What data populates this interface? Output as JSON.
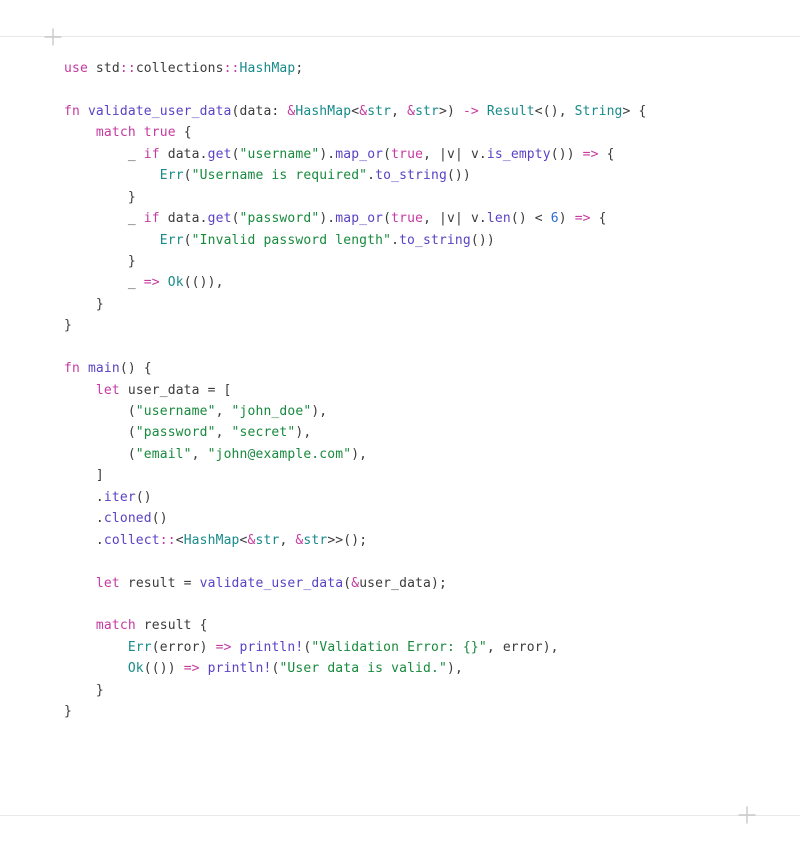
{
  "code": {
    "lines": [
      [
        {
          "cls": "kw",
          "t": "use"
        },
        {
          "cls": "pun",
          "t": " "
        },
        {
          "cls": "path",
          "t": "std"
        },
        {
          "cls": "op",
          "t": "::"
        },
        {
          "cls": "path",
          "t": "collections"
        },
        {
          "cls": "op",
          "t": "::"
        },
        {
          "cls": "ty",
          "t": "HashMap"
        },
        {
          "cls": "pun",
          "t": ";"
        }
      ],
      [],
      [
        {
          "cls": "kw",
          "t": "fn"
        },
        {
          "cls": "pun",
          "t": " "
        },
        {
          "cls": "fn",
          "t": "validate_user_data"
        },
        {
          "cls": "pun",
          "t": "(data: "
        },
        {
          "cls": "op",
          "t": "&"
        },
        {
          "cls": "ty",
          "t": "HashMap"
        },
        {
          "cls": "pun",
          "t": "<"
        },
        {
          "cls": "op",
          "t": "&"
        },
        {
          "cls": "ty",
          "t": "str"
        },
        {
          "cls": "pun",
          "t": ", "
        },
        {
          "cls": "op",
          "t": "&"
        },
        {
          "cls": "ty",
          "t": "str"
        },
        {
          "cls": "pun",
          "t": ">) "
        },
        {
          "cls": "op",
          "t": "->"
        },
        {
          "cls": "pun",
          "t": " "
        },
        {
          "cls": "ty",
          "t": "Result"
        },
        {
          "cls": "pun",
          "t": "<(), "
        },
        {
          "cls": "ty",
          "t": "String"
        },
        {
          "cls": "pun",
          "t": "> {"
        }
      ],
      [
        {
          "cls": "pun",
          "t": "    "
        },
        {
          "cls": "kw",
          "t": "match"
        },
        {
          "cls": "pun",
          "t": " "
        },
        {
          "cls": "bool",
          "t": "true"
        },
        {
          "cls": "pun",
          "t": " {"
        }
      ],
      [
        {
          "cls": "pun",
          "t": "        _ "
        },
        {
          "cls": "kw",
          "t": "if"
        },
        {
          "cls": "pun",
          "t": " data."
        },
        {
          "cls": "fn",
          "t": "get"
        },
        {
          "cls": "pun",
          "t": "("
        },
        {
          "cls": "str",
          "t": "\"username\""
        },
        {
          "cls": "pun",
          "t": ")."
        },
        {
          "cls": "fn",
          "t": "map_or"
        },
        {
          "cls": "pun",
          "t": "("
        },
        {
          "cls": "bool",
          "t": "true"
        },
        {
          "cls": "pun",
          "t": ", |v| v."
        },
        {
          "cls": "fn",
          "t": "is_empty"
        },
        {
          "cls": "pun",
          "t": "()) "
        },
        {
          "cls": "op",
          "t": "=>"
        },
        {
          "cls": "pun",
          "t": " {"
        }
      ],
      [
        {
          "cls": "pun",
          "t": "            "
        },
        {
          "cls": "ty",
          "t": "Err"
        },
        {
          "cls": "pun",
          "t": "("
        },
        {
          "cls": "str",
          "t": "\"Username is required\""
        },
        {
          "cls": "pun",
          "t": "."
        },
        {
          "cls": "fn",
          "t": "to_string"
        },
        {
          "cls": "pun",
          "t": "())"
        }
      ],
      [
        {
          "cls": "pun",
          "t": "        }"
        }
      ],
      [
        {
          "cls": "pun",
          "t": "        _ "
        },
        {
          "cls": "kw",
          "t": "if"
        },
        {
          "cls": "pun",
          "t": " data."
        },
        {
          "cls": "fn",
          "t": "get"
        },
        {
          "cls": "pun",
          "t": "("
        },
        {
          "cls": "str",
          "t": "\"password\""
        },
        {
          "cls": "pun",
          "t": ")."
        },
        {
          "cls": "fn",
          "t": "map_or"
        },
        {
          "cls": "pun",
          "t": "("
        },
        {
          "cls": "bool",
          "t": "true"
        },
        {
          "cls": "pun",
          "t": ", |v| v."
        },
        {
          "cls": "fn",
          "t": "len"
        },
        {
          "cls": "pun",
          "t": "() < "
        },
        {
          "cls": "num",
          "t": "6"
        },
        {
          "cls": "pun",
          "t": ") "
        },
        {
          "cls": "op",
          "t": "=>"
        },
        {
          "cls": "pun",
          "t": " {"
        }
      ],
      [
        {
          "cls": "pun",
          "t": "            "
        },
        {
          "cls": "ty",
          "t": "Err"
        },
        {
          "cls": "pun",
          "t": "("
        },
        {
          "cls": "str",
          "t": "\"Invalid password length\""
        },
        {
          "cls": "pun",
          "t": "."
        },
        {
          "cls": "fn",
          "t": "to_string"
        },
        {
          "cls": "pun",
          "t": "())"
        }
      ],
      [
        {
          "cls": "pun",
          "t": "        }"
        }
      ],
      [
        {
          "cls": "pun",
          "t": "        _ "
        },
        {
          "cls": "op",
          "t": "=>"
        },
        {
          "cls": "pun",
          "t": " "
        },
        {
          "cls": "ty",
          "t": "Ok"
        },
        {
          "cls": "pun",
          "t": "(()),"
        }
      ],
      [
        {
          "cls": "pun",
          "t": "    }"
        }
      ],
      [
        {
          "cls": "pun",
          "t": "}"
        }
      ],
      [],
      [
        {
          "cls": "kw",
          "t": "fn"
        },
        {
          "cls": "pun",
          "t": " "
        },
        {
          "cls": "fn",
          "t": "main"
        },
        {
          "cls": "pun",
          "t": "() {"
        }
      ],
      [
        {
          "cls": "pun",
          "t": "    "
        },
        {
          "cls": "kw",
          "t": "let"
        },
        {
          "cls": "pun",
          "t": " user_data = ["
        }
      ],
      [
        {
          "cls": "pun",
          "t": "        ("
        },
        {
          "cls": "str",
          "t": "\"username\""
        },
        {
          "cls": "pun",
          "t": ", "
        },
        {
          "cls": "str",
          "t": "\"john_doe\""
        },
        {
          "cls": "pun",
          "t": "),"
        }
      ],
      [
        {
          "cls": "pun",
          "t": "        ("
        },
        {
          "cls": "str",
          "t": "\"password\""
        },
        {
          "cls": "pun",
          "t": ", "
        },
        {
          "cls": "str",
          "t": "\"secret\""
        },
        {
          "cls": "pun",
          "t": "),"
        }
      ],
      [
        {
          "cls": "pun",
          "t": "        ("
        },
        {
          "cls": "str",
          "t": "\"email\""
        },
        {
          "cls": "pun",
          "t": ", "
        },
        {
          "cls": "str",
          "t": "\"john@example.com\""
        },
        {
          "cls": "pun",
          "t": "),"
        }
      ],
      [
        {
          "cls": "pun",
          "t": "    ]"
        }
      ],
      [
        {
          "cls": "pun",
          "t": "    ."
        },
        {
          "cls": "fn",
          "t": "iter"
        },
        {
          "cls": "pun",
          "t": "()"
        }
      ],
      [
        {
          "cls": "pun",
          "t": "    ."
        },
        {
          "cls": "fn",
          "t": "cloned"
        },
        {
          "cls": "pun",
          "t": "()"
        }
      ],
      [
        {
          "cls": "pun",
          "t": "    ."
        },
        {
          "cls": "fn",
          "t": "collect"
        },
        {
          "cls": "op",
          "t": "::"
        },
        {
          "cls": "pun",
          "t": "<"
        },
        {
          "cls": "ty",
          "t": "HashMap"
        },
        {
          "cls": "pun",
          "t": "<"
        },
        {
          "cls": "op",
          "t": "&"
        },
        {
          "cls": "ty",
          "t": "str"
        },
        {
          "cls": "pun",
          "t": ", "
        },
        {
          "cls": "op",
          "t": "&"
        },
        {
          "cls": "ty",
          "t": "str"
        },
        {
          "cls": "pun",
          "t": ">>();"
        }
      ],
      [],
      [
        {
          "cls": "pun",
          "t": "    "
        },
        {
          "cls": "kw",
          "t": "let"
        },
        {
          "cls": "pun",
          "t": " result = "
        },
        {
          "cls": "fn",
          "t": "validate_user_data"
        },
        {
          "cls": "pun",
          "t": "("
        },
        {
          "cls": "op",
          "t": "&"
        },
        {
          "cls": "pun",
          "t": "user_data);"
        }
      ],
      [],
      [
        {
          "cls": "pun",
          "t": "    "
        },
        {
          "cls": "kw",
          "t": "match"
        },
        {
          "cls": "pun",
          "t": " result {"
        }
      ],
      [
        {
          "cls": "pun",
          "t": "        "
        },
        {
          "cls": "ty",
          "t": "Err"
        },
        {
          "cls": "pun",
          "t": "(error) "
        },
        {
          "cls": "op",
          "t": "=>"
        },
        {
          "cls": "pun",
          "t": " "
        },
        {
          "cls": "fn",
          "t": "println!"
        },
        {
          "cls": "pun",
          "t": "("
        },
        {
          "cls": "str",
          "t": "\"Validation Error: {}\""
        },
        {
          "cls": "pun",
          "t": ", error),"
        }
      ],
      [
        {
          "cls": "pun",
          "t": "        "
        },
        {
          "cls": "ty",
          "t": "Ok"
        },
        {
          "cls": "pun",
          "t": "(()) "
        },
        {
          "cls": "op",
          "t": "=>"
        },
        {
          "cls": "pun",
          "t": " "
        },
        {
          "cls": "fn",
          "t": "println!"
        },
        {
          "cls": "pun",
          "t": "("
        },
        {
          "cls": "str",
          "t": "\"User data is valid.\""
        },
        {
          "cls": "pun",
          "t": "),"
        }
      ],
      [
        {
          "cls": "pun",
          "t": "    }"
        }
      ],
      [
        {
          "cls": "pun",
          "t": "}"
        }
      ]
    ]
  }
}
